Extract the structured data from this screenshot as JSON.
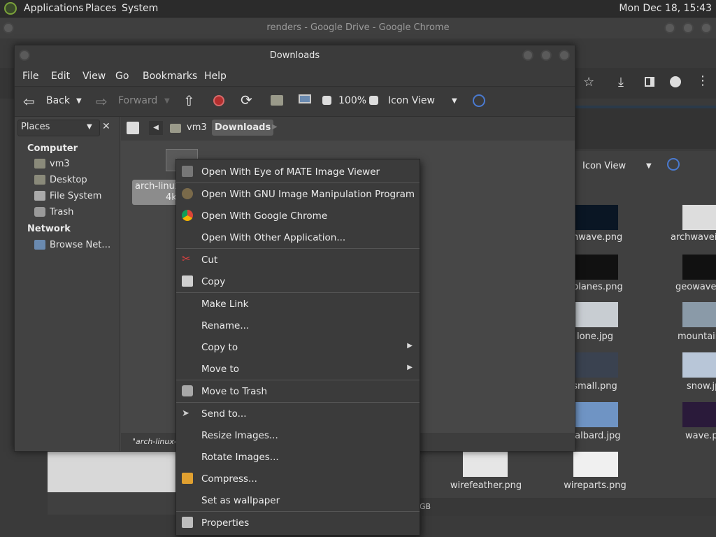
{
  "top_panel": {
    "applications": "Applications",
    "places": "Places",
    "system": "System",
    "clock": "Mon Dec 18, 15:43"
  },
  "chrome": {
    "title": "renders - Google Drive - Google Chrome",
    "icon_view": "Icon View",
    "status_fragment": "GB",
    "files": [
      {
        "name": "chwave.png"
      },
      {
        "name": "archwavein"
      },
      {
        "name": "eolanes.png"
      },
      {
        "name": "geowaves"
      },
      {
        "name": "lone.jpg"
      },
      {
        "name": "mountain"
      },
      {
        "name": "small.png"
      },
      {
        "name": "snow.jp"
      },
      {
        "name": "valbard.jpg"
      },
      {
        "name": "wave.p"
      },
      {
        "name": "wirefeather.png"
      },
      {
        "name": "wireparts.png"
      }
    ]
  },
  "caja": {
    "title": "Downloads",
    "menu": [
      "File",
      "Edit",
      "View",
      "Go",
      "Bookmarks",
      "Help"
    ],
    "toolbar": {
      "back": "Back",
      "forward": "Forward",
      "zoom": "100%",
      "view_mode": "Icon View"
    },
    "sidebar": {
      "places_label": "Places",
      "computer_header": "Computer",
      "computer_items": [
        "vm3",
        "Desktop",
        "File System",
        "Trash"
      ],
      "network_header": "Network",
      "network_items": [
        "Browse Net…"
      ]
    },
    "pathbar": {
      "segments": [
        "vm3",
        "Downloads"
      ]
    },
    "file": {
      "name_line1": "arch-linux",
      "name_line2": "4k"
    },
    "status": "\"arch-linux-"
  },
  "context_menu": {
    "items": [
      {
        "label": "Open With Eye of MATE Image Viewer",
        "icon": "image-viewer-icon"
      },
      {
        "label": "Open With GNU Image Manipulation Program",
        "icon": "gimp-icon"
      },
      {
        "label": "Open With Google Chrome",
        "icon": "chrome-icon"
      },
      {
        "label": "Open With Other Application...",
        "icon": ""
      },
      {
        "label": "Cut",
        "icon": "scissors-icon"
      },
      {
        "label": "Copy",
        "icon": "copy-icon"
      },
      {
        "label": "Make Link",
        "icon": ""
      },
      {
        "label": "Rename...",
        "icon": ""
      },
      {
        "label": "Copy to",
        "icon": ""
      },
      {
        "label": "Move to",
        "icon": ""
      },
      {
        "label": "Move to Trash",
        "icon": "trash-icon"
      },
      {
        "label": "Send to...",
        "icon": "send-icon"
      },
      {
        "label": "Resize Images...",
        "icon": ""
      },
      {
        "label": "Rotate Images...",
        "icon": ""
      },
      {
        "label": "Compress...",
        "icon": "archive-icon"
      },
      {
        "label": "Set as wallpaper",
        "icon": ""
      },
      {
        "label": "Properties",
        "icon": "properties-icon"
      }
    ]
  },
  "colors": {
    "accent": "#5a8ac6",
    "panel": "#2b2b2b",
    "menu_bg": "#3b3b3b",
    "stop_red": "#d03b3b"
  }
}
